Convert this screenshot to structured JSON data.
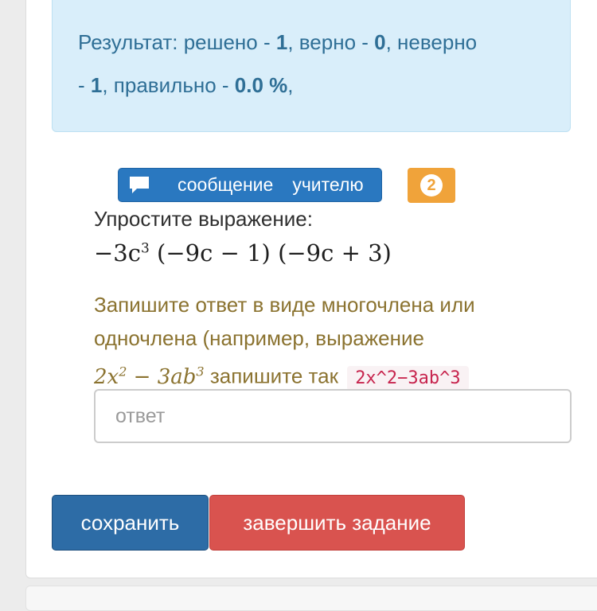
{
  "result": {
    "label": "Результат: решено - ",
    "solved": "1",
    "sep_correct": ", верно - ",
    "correct": "0",
    "sep_wrong": ", неверно",
    "line2_prefix": "- ",
    "wrong": "1",
    "sep_percent": ", правильно - ",
    "percent": "0.0 %",
    "trailing": ","
  },
  "message_button": {
    "word1": "сообщение",
    "word2": "учителю",
    "icon": "chat-bubble-icon"
  },
  "badge": {
    "count": "2"
  },
  "question": {
    "title": "Упростите выражение:",
    "expression": {
      "a": "−3c",
      "a_exp": "3",
      "rest": " (−9c − 1) (−9c + 3)"
    }
  },
  "hint": {
    "text1": "Запишите ответ в виде многочлена или одночлена (например, выражение",
    "math_a": "2x",
    "math_a_exp": "2",
    "math_mid": " − 3ab",
    "math_b_exp": "3",
    "text2": " запишите так ",
    "code_example": "2x^2−3ab^3"
  },
  "answer_input": {
    "placeholder": "ответ",
    "value": ""
  },
  "buttons": {
    "save": "сохранить",
    "finish": "завершить задание"
  },
  "colors": {
    "info_bg": "#d9eefa",
    "primary": "#2a78c0",
    "warning": "#f0a33a",
    "danger": "#d9534f",
    "save": "#2d6ca6",
    "hint_text": "#8b7330",
    "code_text": "#c7254e"
  }
}
